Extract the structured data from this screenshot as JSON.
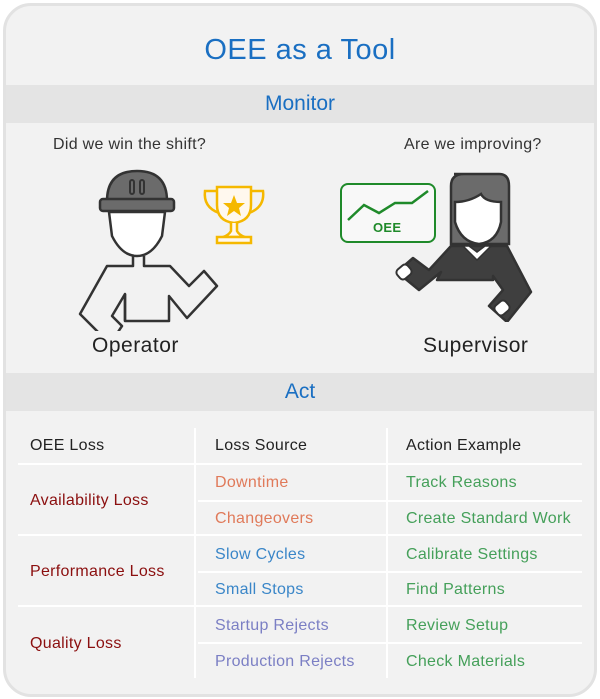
{
  "title": "OEE as a Tool",
  "sections": {
    "monitor": "Monitor",
    "act": "Act"
  },
  "monitor": {
    "operator": {
      "question": "Did we win the shift?",
      "role": "Operator",
      "icon": "trophy-icon"
    },
    "supervisor": {
      "question": "Are we improving?",
      "role": "Supervisor",
      "icon": "oee-chart-icon",
      "chart_label": "OEE"
    }
  },
  "colors": {
    "title": "#1a6fc2",
    "loss": "#8b0f0f",
    "availability_source": "#e07a5a",
    "performance_source": "#3a86c8",
    "quality_source": "#7b7fc4",
    "action": "#45a05a",
    "trophy": "#f5b800",
    "oee_chart": "#1f8a2a"
  },
  "table": {
    "headers": [
      "OEE Loss",
      "Loss Source",
      "Action Example"
    ],
    "groups": [
      {
        "loss": "Availability Loss",
        "rows": [
          {
            "source": "Downtime",
            "action": "Track Reasons"
          },
          {
            "source": "Changeovers",
            "action": "Create Standard Work"
          }
        ]
      },
      {
        "loss": "Performance Loss",
        "rows": [
          {
            "source": "Slow Cycles",
            "action": "Calibrate Settings"
          },
          {
            "source": "Small Stops",
            "action": "Find Patterns"
          }
        ]
      },
      {
        "loss": "Quality Loss",
        "rows": [
          {
            "source": "Startup Rejects",
            "action": "Review Setup"
          },
          {
            "source": "Production Rejects",
            "action": "Check Materials"
          }
        ]
      }
    ]
  }
}
